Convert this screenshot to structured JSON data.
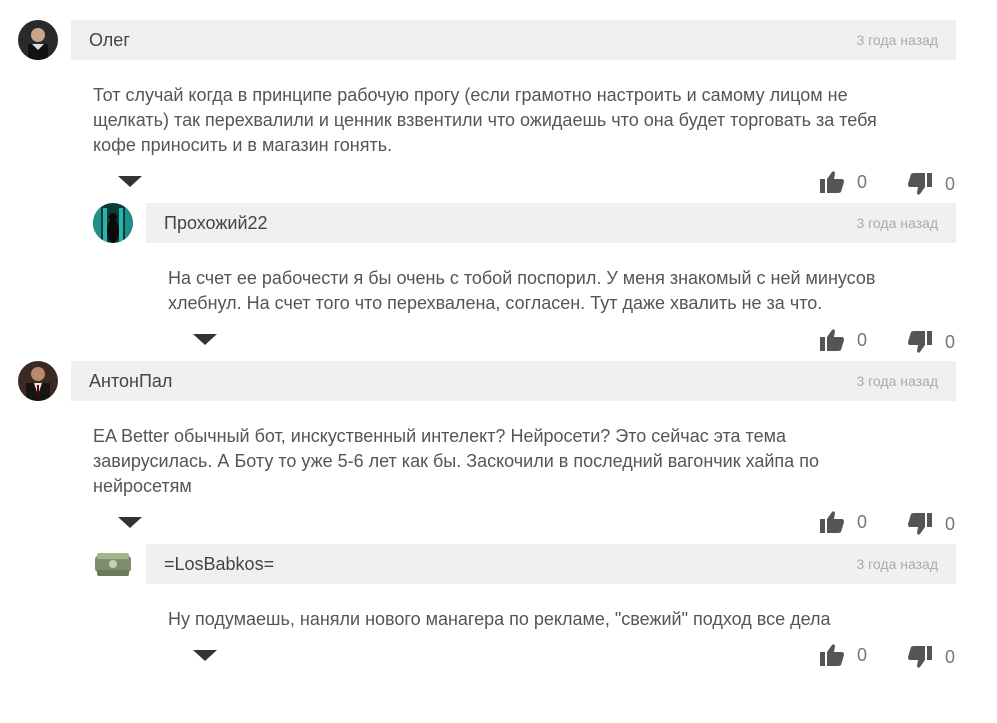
{
  "comments": [
    {
      "author": "Олег",
      "time": "3 года назад",
      "text_lines": [
        "Тот случай когда в принципе рабочую прогу (если грамотно настроить и самому лицом не",
        "щелкать) так перехвалили и ценник взвентили что ожидаешь что она будет торговать за тебя",
        "кофе приносить и в магазин гонять."
      ],
      "likes": "0",
      "dislikes": "0"
    },
    {
      "author": "Прохожий22",
      "time": "3 года назад",
      "text_lines": [
        "На счет ее рабочести я бы очень с тобой поспорил. У меня знакомый с ней минусов",
        "хлебнул. На счет того что перехвалена, согласен. Тут даже хвалить не за что."
      ],
      "likes": "0",
      "dislikes": "0"
    },
    {
      "author": "АнтонПал",
      "time": "3 года назад",
      "text_lines": [
        "EA Better обычный бот, инскуственный интелект? Нейросети? Это сейчас эта тема",
        "завирусилась. А Боту то уже 5-6 лет как бы. Заскочили в последний вагончик хайпа по",
        "нейросетям"
      ],
      "likes": "0",
      "dislikes": "0"
    },
    {
      "author": "=LosBabkos=",
      "time": "3 года назад",
      "text_lines": [
        "Ну подумаешь, наняли нового манагера по рекламе, \"свежий\" подход все дела"
      ],
      "likes": "0",
      "dislikes": "0"
    }
  ],
  "icons": {
    "like": "thumbs-up-icon",
    "dislike": "thumbs-down-icon",
    "expand": "expand-replies-icon"
  },
  "colors": {
    "header_bg": "#f0f0f0",
    "text": "#555555",
    "icon": "#555555"
  }
}
